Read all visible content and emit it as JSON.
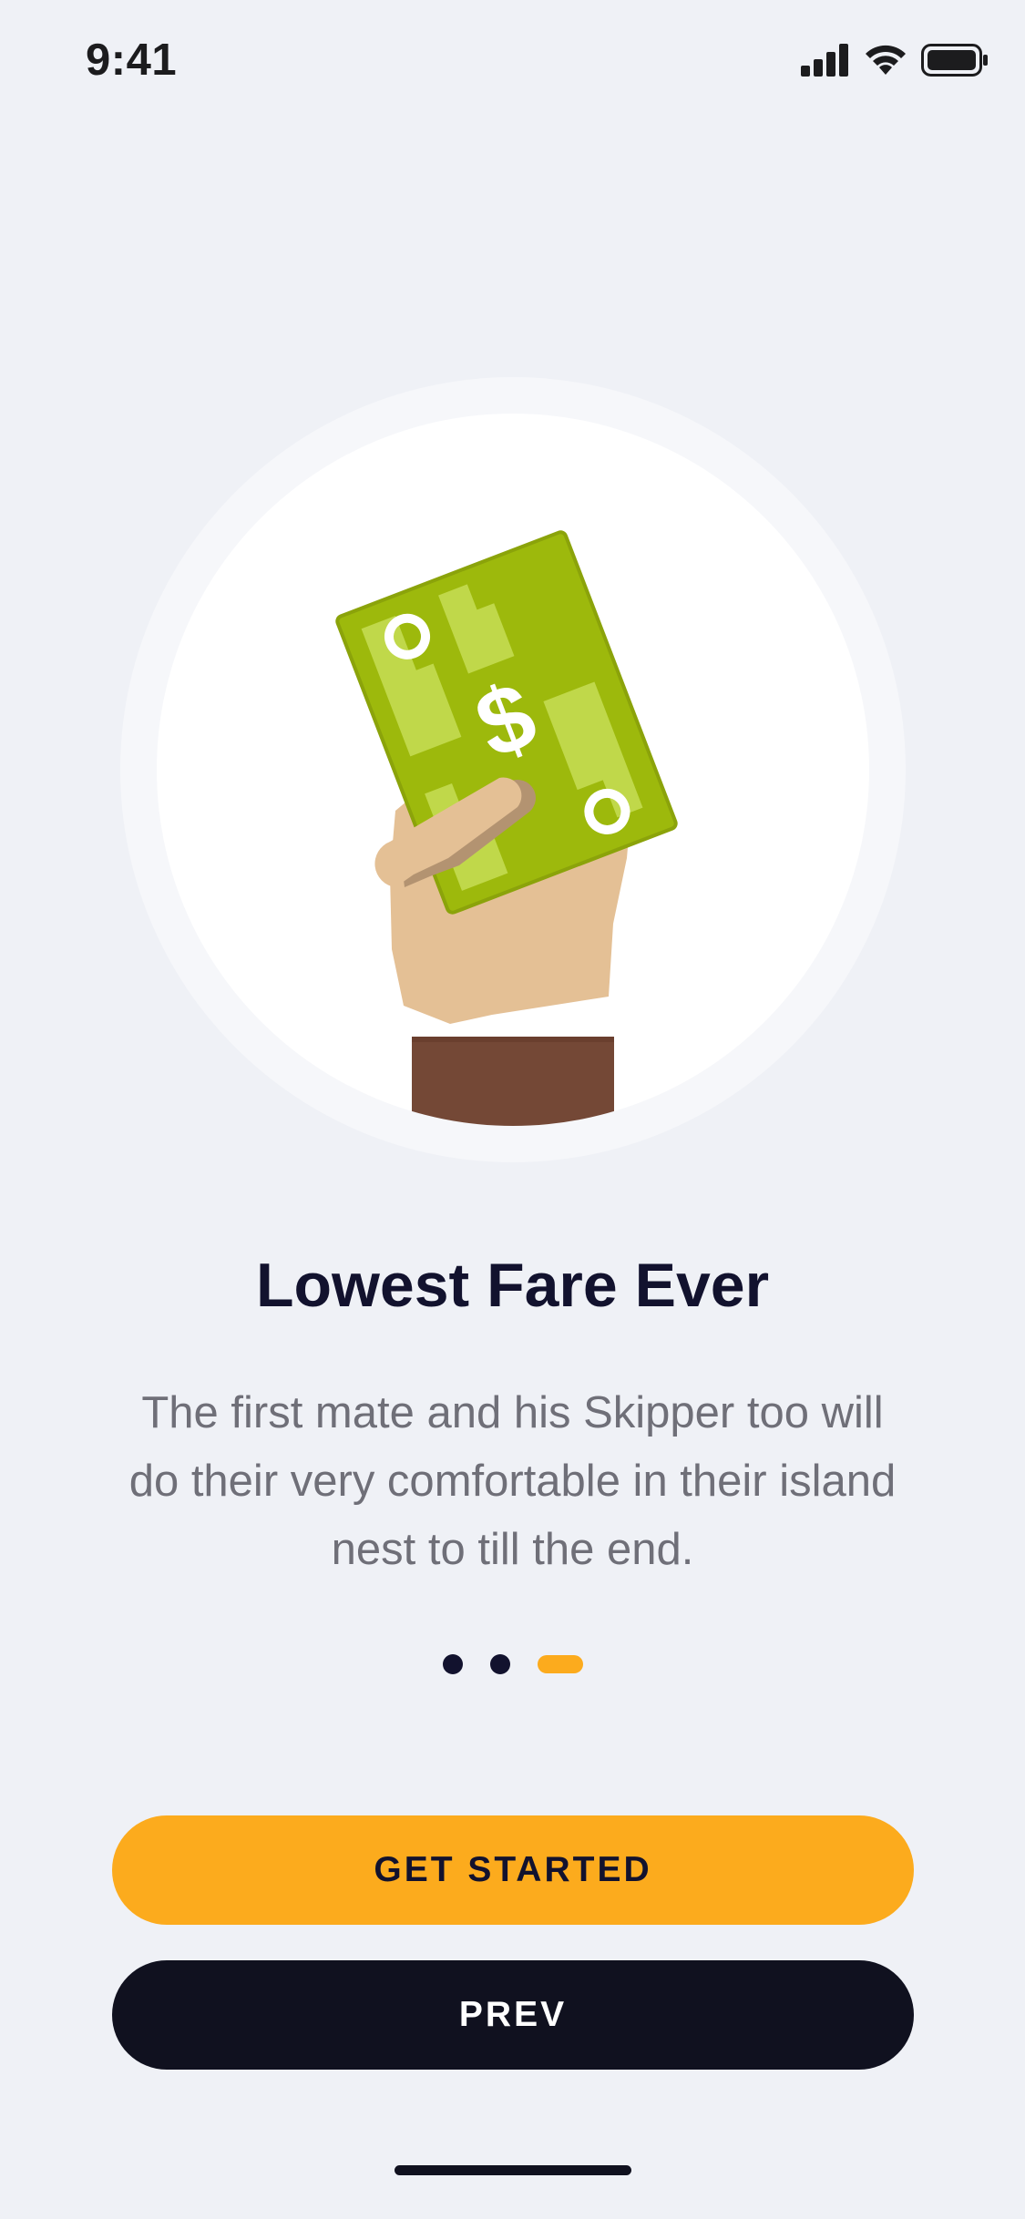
{
  "status_bar": {
    "time": "9:41",
    "icons": [
      "cellular-signal-icon",
      "wifi-icon",
      "battery-icon"
    ]
  },
  "hero": {
    "illustration": "hand-holding-cash-illustration",
    "bill_symbol": "$"
  },
  "onboarding": {
    "title": "Lowest Fare Ever",
    "description": "The first mate and his Skipper too will do their very comfortable in their island nest to till the end.",
    "page_count": 3,
    "current_page": 3
  },
  "actions": {
    "primary_label": "GET STARTED",
    "secondary_label": "PREV"
  },
  "colors": {
    "background": "#eff1f6",
    "accent": "#fcab1d",
    "dark": "#10111f",
    "title": "#12122e",
    "body_text": "#6f6f78",
    "bill_green": "#9db90c",
    "bill_light": "#c0d84a",
    "skin": "#e4c095",
    "sleeve": "#744836"
  }
}
